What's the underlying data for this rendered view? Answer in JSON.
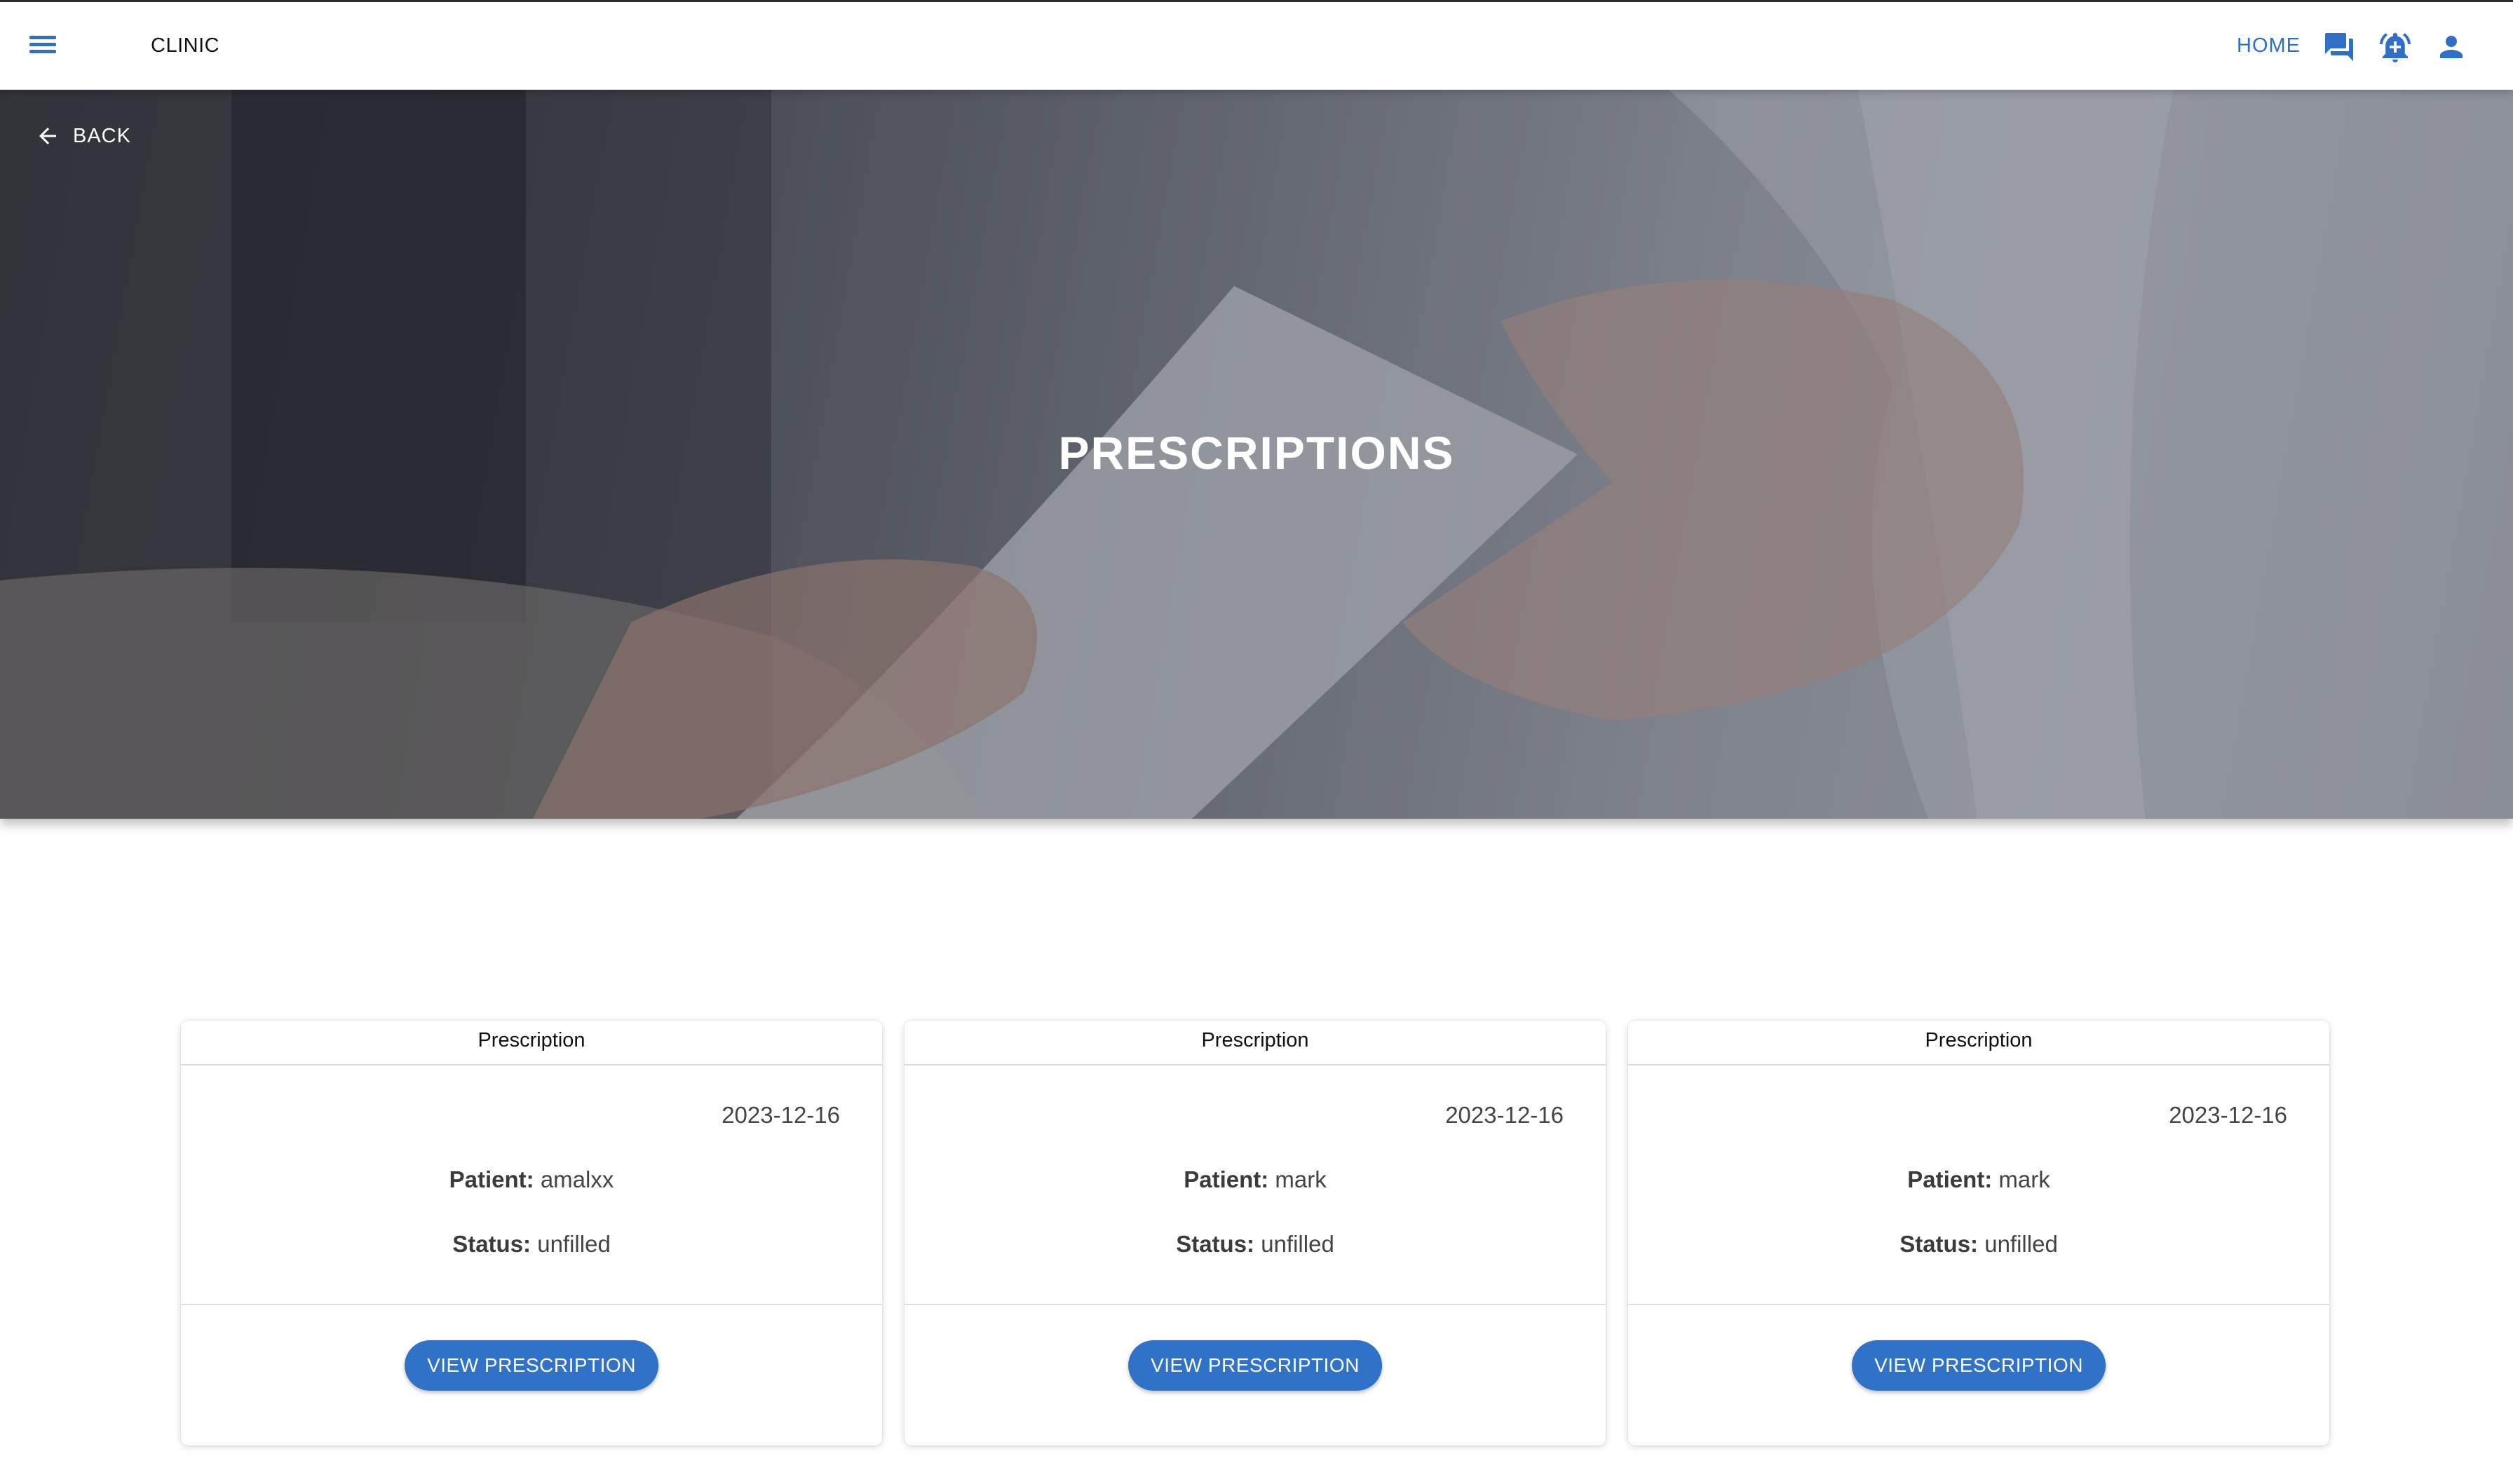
{
  "app": {
    "brand": "CLINIC",
    "nav": {
      "home_label": "HOME"
    },
    "icons": {
      "menu": "menu-icon",
      "chat": "chat-icon",
      "notifications": "notifications-icon",
      "account": "person-icon"
    }
  },
  "hero": {
    "back_label": "BACK",
    "title": "PRESCRIPTIONS"
  },
  "prescriptions": [
    {
      "header": "Prescription",
      "date": "2023-12-16",
      "patient_label": "Patient:",
      "patient": "amalxx",
      "status_label": "Status:",
      "status": "unfilled",
      "button_label": "VIEW PRESCRIPTION"
    },
    {
      "header": "Prescription",
      "date": "2023-12-16",
      "patient_label": "Patient:",
      "patient": "mark",
      "status_label": "Status:",
      "status": "unfilled",
      "button_label": "VIEW PRESCRIPTION"
    },
    {
      "header": "Prescription",
      "date": "2023-12-16",
      "patient_label": "Patient:",
      "patient": "mark",
      "status_label": "Status:",
      "status": "unfilled",
      "button_label": "VIEW PRESCRIPTION"
    }
  ],
  "colors": {
    "accent": "#2f72c8",
    "topbar": "#ffffff",
    "text": "#444444"
  }
}
